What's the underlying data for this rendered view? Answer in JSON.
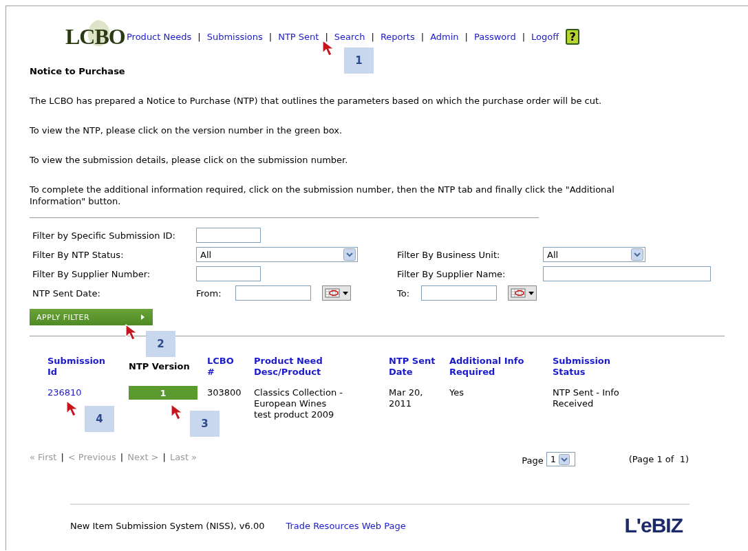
{
  "header": {
    "logo": "LCBO",
    "nav_separator": "|",
    "nav": [
      {
        "label": "Product Needs"
      },
      {
        "label": "Submissions"
      },
      {
        "label": "NTP Sent"
      },
      {
        "label": "Search"
      },
      {
        "label": "Reports"
      },
      {
        "label": "Admin"
      },
      {
        "label": "Password"
      },
      {
        "label": "Logoff"
      }
    ],
    "help": "?"
  },
  "title": "Notice to Purchase",
  "paragraphs": [
    "The LCBO has prepared a Notice to Purchase (NTP) that outlines the parameters based on which the purchase order will be cut.",
    "To view the NTP, please click on the version number in the green box.",
    "To view the submission details, please click on the submission number.",
    "To complete the additional information required, click on the submission number, then the NTP tab and finally click the \"Additional Information\" button."
  ],
  "filters": {
    "rows": [
      {
        "left": {
          "label": "Filter by Specific Submission ID:",
          "field": {
            "kind": "text"
          }
        }
      },
      {
        "left": {
          "label": "Filter By NTP Status:",
          "field": {
            "kind": "select",
            "value": "All"
          }
        },
        "right": {
          "label": "Filter By Business Unit:",
          "field": {
            "kind": "select",
            "value": "All"
          }
        }
      },
      {
        "left": {
          "label": "Filter By Supplier Number:",
          "field": {
            "kind": "text"
          }
        },
        "right": {
          "label": "Filter By Supplier Name:",
          "field": {
            "kind": "text"
          }
        }
      },
      {
        "left": {
          "label": "NTP Sent Date:",
          "field": {
            "kind": "date",
            "prefix": "From:"
          }
        },
        "right": {
          "field": {
            "kind": "date",
            "prefix": "To:"
          }
        }
      }
    ],
    "button": "APPLY FILTER"
  },
  "table": {
    "columns": [
      {
        "label": "Submission Id",
        "link": true
      },
      {
        "label": "NTP Version",
        "link": false
      },
      {
        "label": "LCBO #",
        "link": true
      },
      {
        "label": "Product Need Desc/Product",
        "link": true
      },
      {
        "label": "NTP Sent Date",
        "link": true
      },
      {
        "label": "Additional Info Required",
        "link": true
      },
      {
        "label": "Submission Status",
        "link": true
      }
    ],
    "rows": [
      {
        "submission_id": "236810",
        "ntp_version": "1",
        "lcbo": "303800",
        "product": [
          "Classics Collection - European Wines",
          "test product 2009"
        ],
        "sent_date": "Mar 20, 2011",
        "additional_info": "Yes",
        "status": "NTP Sent - Info Received"
      }
    ]
  },
  "pager": {
    "separator": "|",
    "links": [
      {
        "label": "« First",
        "disabled": true
      },
      {
        "label": "< Previous",
        "disabled": true
      },
      {
        "label": "Next >",
        "disabled": true
      },
      {
        "label": "Last »",
        "disabled": true
      }
    ],
    "page_label": "Page",
    "page_value": "1",
    "summary": "(Page 1 of  1)"
  },
  "footer": {
    "system": "New Item Submission System (NISS), v6.00",
    "link": "Trade Resources Web Page",
    "logo": "L'eBIZ"
  },
  "callouts": [
    {
      "number": "1"
    },
    {
      "number": "2"
    },
    {
      "number": "3"
    },
    {
      "number": "4"
    }
  ]
}
